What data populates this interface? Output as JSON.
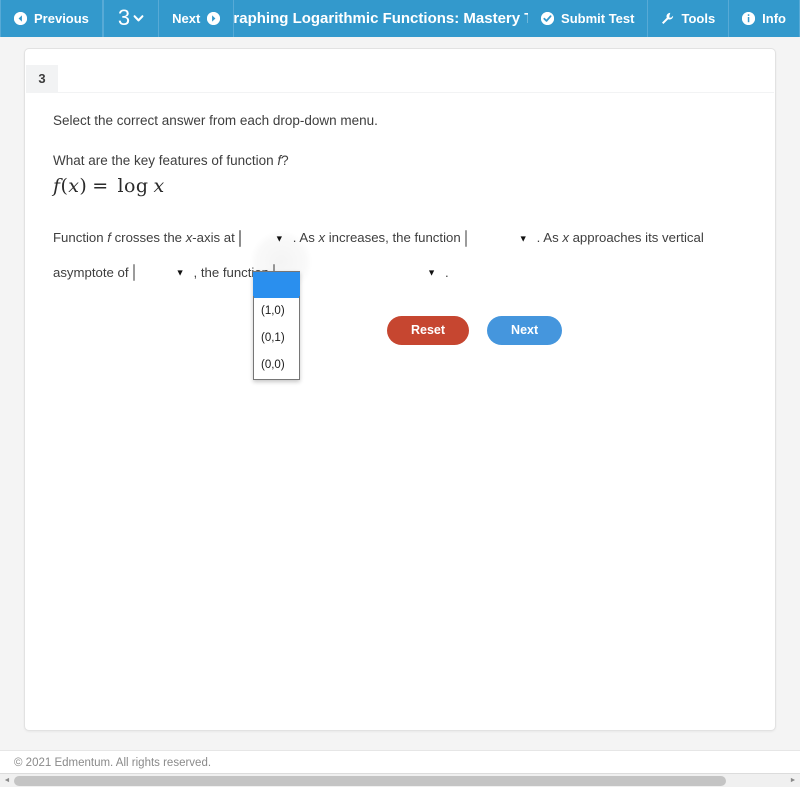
{
  "topbar": {
    "previous_label": "Previous",
    "question_number": "3",
    "next_label": "Next",
    "title": "Graphing Logarithmic Functions: Mastery Te",
    "submit_label": "Submit Test",
    "tools_label": "Tools",
    "info_label": "Info",
    "accent_color": "#3399cc",
    "icons": {
      "previous": "arrow-left-circle-icon",
      "question_caret": "chevron-down-icon",
      "next": "arrow-right-circle-icon",
      "submit": "check-circle-icon",
      "tools": "wrench-icon",
      "info": "info-circle-icon"
    }
  },
  "question": {
    "tab_number": "3",
    "instruction": "Select the correct answer from each drop-down menu.",
    "prompt_before": "What are the key features of function ",
    "prompt_italic": "f",
    "prompt_after": "?",
    "formula": {
      "lhs_f": "f",
      "lhs_paren_open": "(",
      "lhs_var": "x",
      "lhs_paren_close": ")",
      "equals": "=",
      "log": "log",
      "arg": "x",
      "plain": "f(x) = log x"
    },
    "sentence": {
      "part1": "Function ",
      "italic1": "f",
      "part2": " crosses the ",
      "italic2": "x",
      "part3": "-axis at",
      "part4": ". As ",
      "italic3": "x",
      "part5": " increases, the function",
      "part6": ". As ",
      "italic4": "x",
      "part7": " approaches its vertical asymptote of",
      "part8": ", the function",
      "part9": "."
    },
    "dropdowns": [
      {
        "name": "x-intercept",
        "value": "",
        "open": true
      },
      {
        "name": "increase-behavior",
        "value": "",
        "open": false
      },
      {
        "name": "asymptote-value",
        "value": "",
        "open": false
      },
      {
        "name": "asymptote-behavior",
        "value": "",
        "open": false
      }
    ],
    "open_dropdown": {
      "selected_index": 0,
      "options": [
        "",
        "(1,0)",
        "(0,1)",
        "(0,0)"
      ],
      "highlight_color": "#2a8fee"
    }
  },
  "actions": {
    "reset_label": "Reset",
    "next_label": "Next",
    "reset_color": "#c64630",
    "next_color": "#4596dd"
  },
  "footer": {
    "copyright": "© 2021 Edmentum. All rights reserved."
  },
  "scrollbar": {
    "left_arrow": "◄",
    "right_arrow": "►"
  }
}
